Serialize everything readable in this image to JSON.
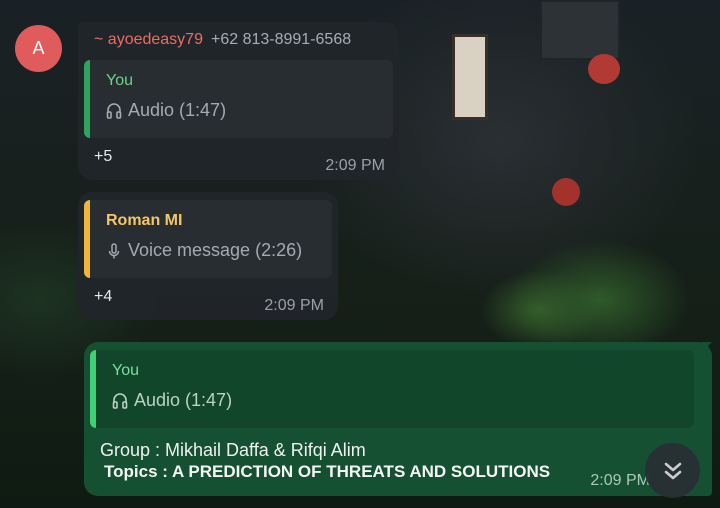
{
  "avatar": {
    "initial": "A",
    "color": "#e05b5b"
  },
  "messages": [
    {
      "sender_name": "~ ayoedeasy79",
      "sender_phone": "+62 813-8991-6568",
      "quote": {
        "author": "You",
        "icon": "headphones-icon",
        "text": "Audio (1:47)",
        "bar_color": "#2ea55a"
      },
      "count": "+5",
      "time": "2:09 PM"
    },
    {
      "quote": {
        "author": "Roman MI",
        "icon": "microphone-icon",
        "text": "Voice message (2:26)",
        "bar_color": "#f1b53c"
      },
      "count": "+4",
      "time": "2:09 PM"
    },
    {
      "outgoing": true,
      "quote": {
        "author": "You",
        "icon": "headphones-icon",
        "text": "Audio (1:47)",
        "bar_color": "#3fd173"
      },
      "line1": "Group : Mikhail Daffa & Rifqi Alim",
      "line2": "Topics : A PREDICTION OF THREATS AND SOLUTIONS",
      "time": "2:09 PM"
    }
  ],
  "scroll_button": {
    "icon": "double-chevron-down-icon"
  }
}
